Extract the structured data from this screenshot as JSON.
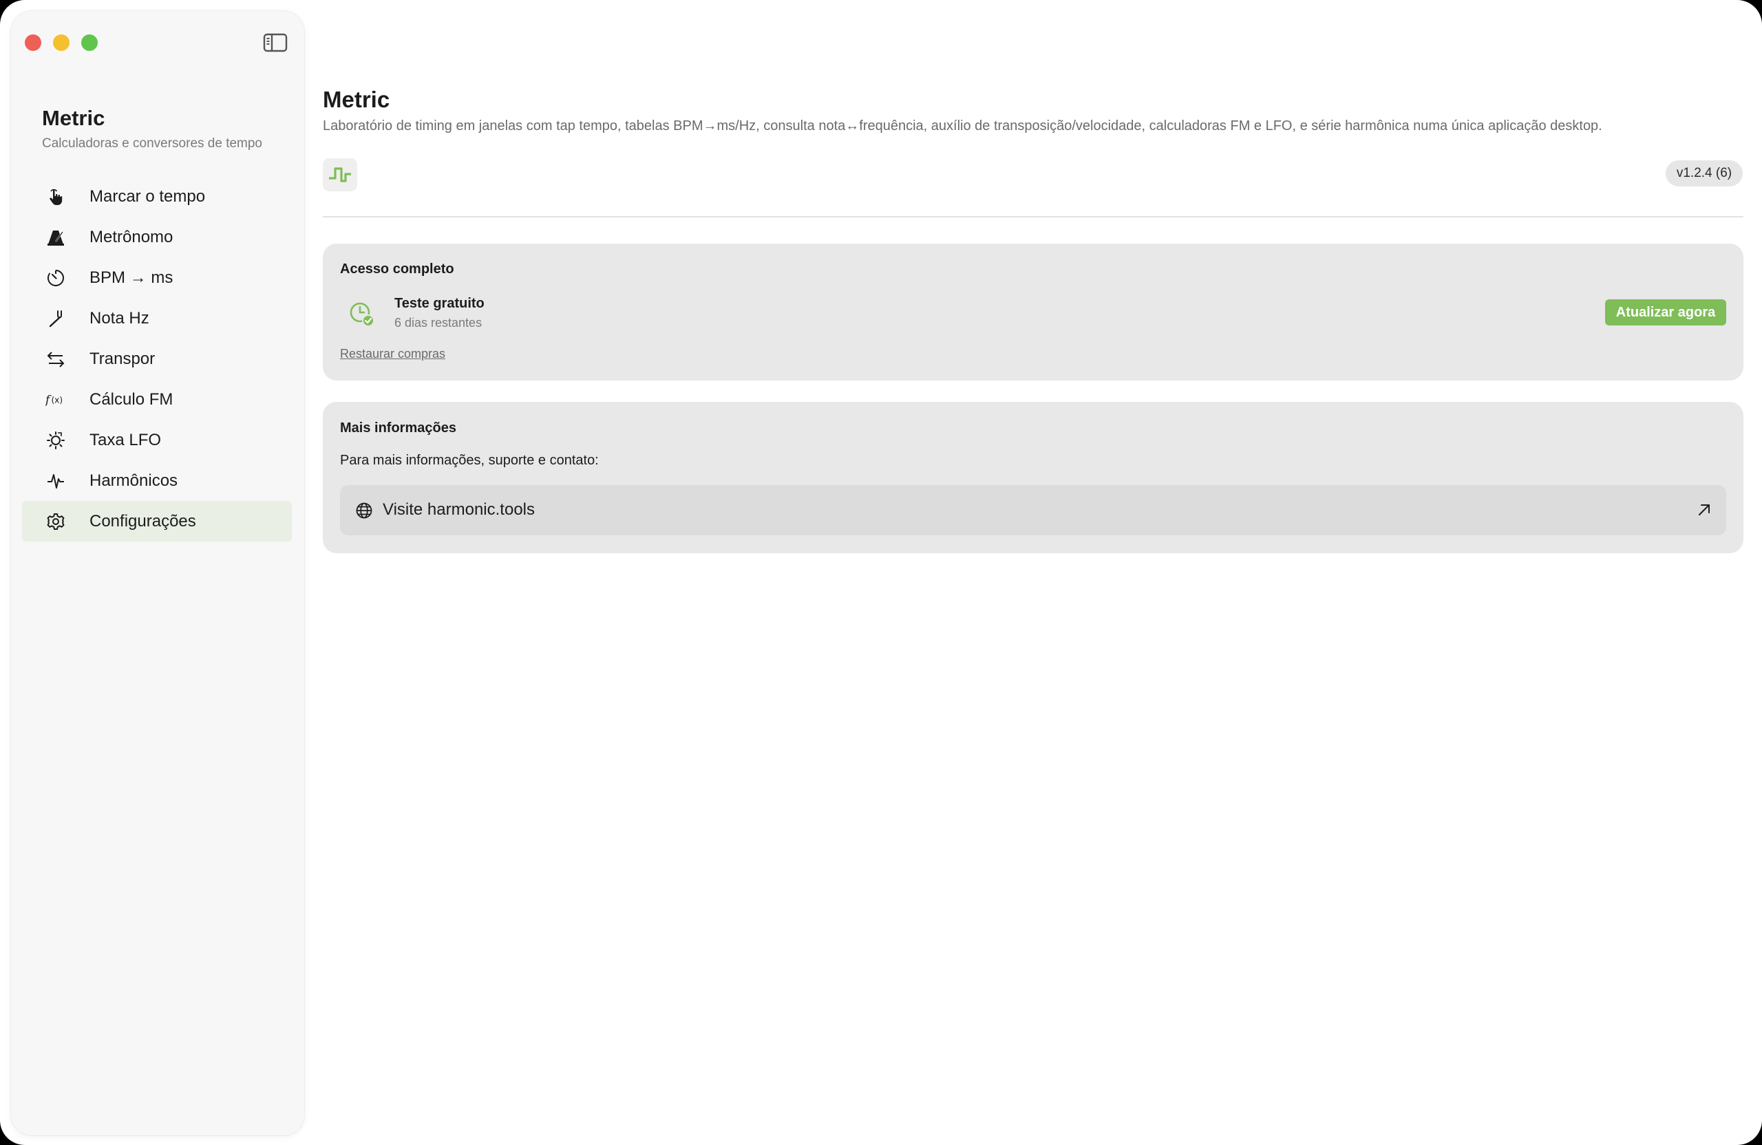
{
  "window": {
    "controls": [
      "close",
      "minimize",
      "zoom"
    ]
  },
  "sidebar": {
    "app_name": "Metric",
    "app_tagline": "Calculadoras e conversores de tempo",
    "toggle_icon": "sidebar-toggle-icon",
    "items": [
      {
        "label": "Marcar o tempo",
        "icon": "tap-hand-icon",
        "active": false
      },
      {
        "label": "Metrônomo",
        "icon": "metronome-icon",
        "active": false
      },
      {
        "label": "BPM → ms",
        "icon": "timer-icon",
        "active": false
      },
      {
        "label": "Nota Hz",
        "icon": "tuning-fork-icon",
        "active": false
      },
      {
        "label": "Transpor",
        "icon": "swap-arrows-icon",
        "active": false
      },
      {
        "label": "Cálculo FM",
        "icon": "function-icon",
        "active": false
      },
      {
        "label": "Taxa LFO",
        "icon": "lfo-sun-icon",
        "active": false
      },
      {
        "label": "Harmônicos",
        "icon": "waveform-icon",
        "active": false
      },
      {
        "label": "Configurações",
        "icon": "gear-icon",
        "active": true
      }
    ]
  },
  "main": {
    "title": "Metric",
    "description": "Laboratório de timing em janelas com tap tempo, tabelas BPM→ms/Hz, consulta nota↔frequência, auxílio de transposição/velocidade, calculadoras FM e LFO, e série harmônica numa única aplicação desktop.",
    "version": "v1.2.4 (6)",
    "access": {
      "title": "Acesso completo",
      "trial_title": "Teste gratuito",
      "trial_remaining": "6 dias restantes",
      "upgrade_label": "Atualizar agora",
      "restore_label": "Restaurar compras"
    },
    "info": {
      "title": "Mais informações",
      "text": "Para mais informações, suporte e contato:",
      "visit_label": "Visite harmonic.tools"
    }
  },
  "colors": {
    "accent": "#7fbd58",
    "active_nav_bg": "#e9efe4",
    "card_bg": "#e8e8e8"
  }
}
